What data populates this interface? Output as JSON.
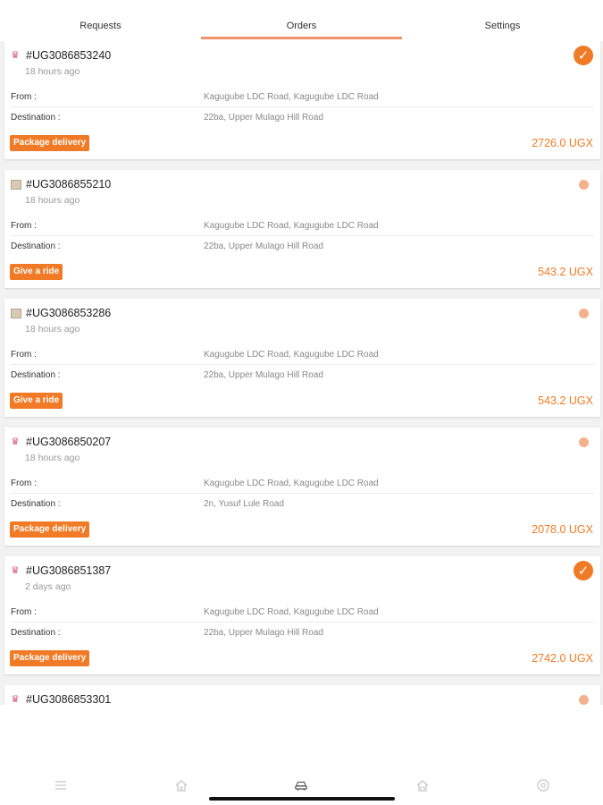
{
  "tabs": [
    {
      "label": "Requests",
      "active": false
    },
    {
      "label": "Orders",
      "active": true
    },
    {
      "label": "Settings",
      "active": false
    }
  ],
  "colors": {
    "accent": "#f07a26",
    "tab_underline": "#f0936f",
    "pending_dot": "#f5b08d"
  },
  "orders": [
    {
      "id": "#UG3086853240",
      "time": "18 hours ago",
      "from_label": "From :",
      "from": "Kagugube LDC Road, Kagugube LDC Road",
      "dest_label": "Destination :",
      "destination": "22ba, Upper Mulago Hill Road",
      "type": "Package delivery",
      "price": "2726.0 UGX",
      "status": "completed",
      "icon": "package-icon"
    },
    {
      "id": "#UG3086855210",
      "time": "18 hours ago",
      "from_label": "From :",
      "from": "Kagugube LDC Road, Kagugube LDC Road",
      "dest_label": "Destination :",
      "destination": "22ba, Upper Mulago Hill Road",
      "type": "Give a ride",
      "price": "543.2 UGX",
      "status": "pending",
      "icon": "ride-icon"
    },
    {
      "id": "#UG3086853286",
      "time": "18 hours ago",
      "from_label": "From :",
      "from": "Kagugube LDC Road, Kagugube LDC Road",
      "dest_label": "Destination :",
      "destination": "22ba, Upper Mulago Hill Road",
      "type": "Give a ride",
      "price": "543.2 UGX",
      "status": "pending",
      "icon": "ride-icon"
    },
    {
      "id": "#UG3086850207",
      "time": "18 hours ago",
      "from_label": "From :",
      "from": "Kagugube LDC Road, Kagugube LDC Road",
      "dest_label": "Destination :",
      "destination": "2n, Yusuf Lule Road",
      "type": "Package delivery",
      "price": "2078.0 UGX",
      "status": "pending",
      "icon": "package-icon"
    },
    {
      "id": "#UG3086851387",
      "time": "2 days ago",
      "from_label": "From :",
      "from": "Kagugube LDC Road, Kagugube LDC Road",
      "dest_label": "Destination :",
      "destination": "22ba, Upper Mulago Hill Road",
      "type": "Package delivery",
      "price": "2742.0 UGX",
      "status": "completed",
      "icon": "package-icon"
    },
    {
      "id": "#UG3086853301",
      "status": "pending",
      "icon": "package-icon"
    }
  ],
  "bottom_nav": [
    {
      "icon": "menu-icon"
    },
    {
      "icon": "home-icon"
    },
    {
      "icon": "car-icon",
      "active": true
    },
    {
      "icon": "house-icon"
    },
    {
      "icon": "settings-icon"
    }
  ]
}
